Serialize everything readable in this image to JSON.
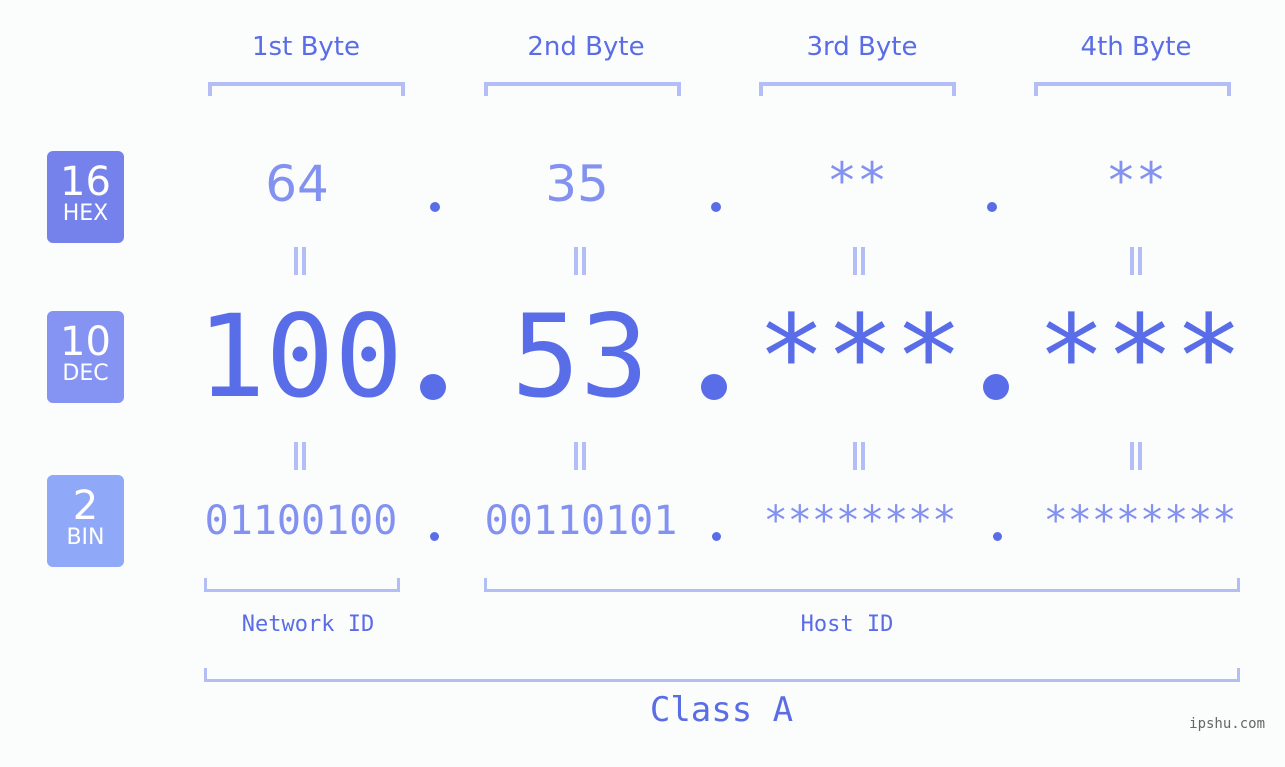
{
  "bytes": [
    {
      "header": "1st Byte",
      "hex": "64",
      "dec": "100",
      "bin": "01100100"
    },
    {
      "header": "2nd Byte",
      "hex": "35",
      "dec": "53",
      "bin": "00110101"
    },
    {
      "header": "3rd Byte",
      "hex": "**",
      "dec": "***",
      "bin": "********"
    },
    {
      "header": "4th Byte",
      "hex": "**",
      "dec": "***",
      "bin": "********"
    }
  ],
  "badges": {
    "hex": {
      "num": "16",
      "label": "HEX",
      "color": "#7582ec"
    },
    "dec": {
      "num": "10",
      "label": "DEC",
      "color": "#8593f2"
    },
    "bin": {
      "num": "2",
      "label": "BIN",
      "color": "#8fa8f8"
    }
  },
  "labels": {
    "network_id": "Network ID",
    "host_id": "Host ID",
    "class": "Class A"
  },
  "watermark": "ipshu.com",
  "colors": {
    "accent": "#5a6de9",
    "light_text": "#8391f0",
    "bracket": "#b3bdf6",
    "background": "#fbfdfc"
  }
}
